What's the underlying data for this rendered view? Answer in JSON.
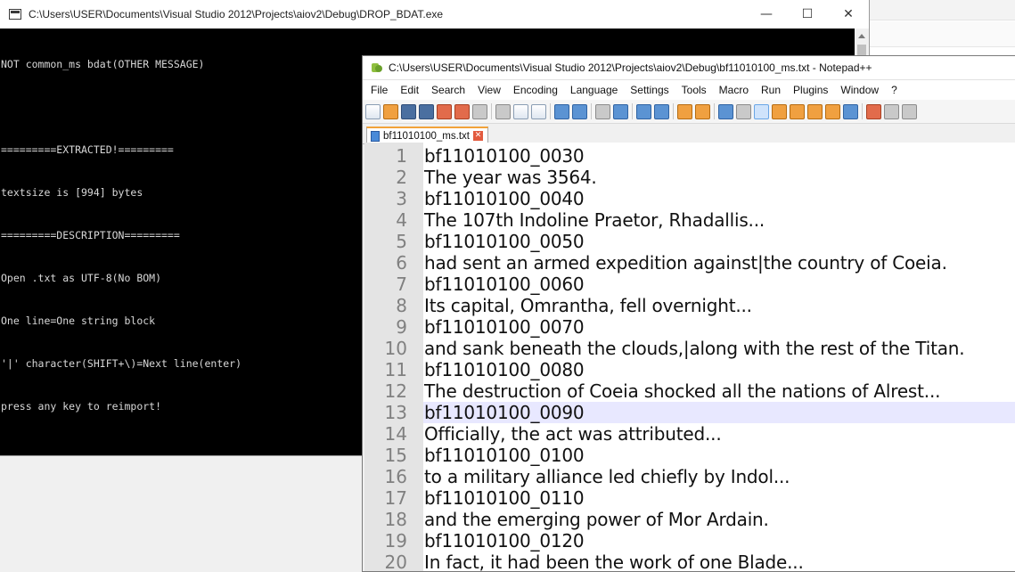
{
  "console": {
    "title": "C:\\Users\\USER\\Documents\\Visual Studio 2012\\Projects\\aiov2\\Debug\\DROP_BDAT.exe",
    "lines": [
      "NOT common_ms bdat(OTHER MESSAGE)",
      "",
      "=========EXTRACTED!=========",
      "textsize is [994] bytes",
      "=========DESCRIPTION=========",
      "Open .txt as UTF-8(No BOM)",
      "One line=One string block",
      "'|' character(SHIFT+\\)=Next line(enter)",
      "press any key to reimport!"
    ]
  },
  "window_buttons": {
    "minimize": "—",
    "maximize": "☐",
    "close": "✕"
  },
  "notepad": {
    "title": "C:\\Users\\USER\\Documents\\Visual Studio 2012\\Projects\\aiov2\\Debug\\bf11010100_ms.txt - Notepad++",
    "menu": [
      "File",
      "Edit",
      "Search",
      "View",
      "Encoding",
      "Language",
      "Settings",
      "Tools",
      "Macro",
      "Run",
      "Plugins",
      "Window",
      "?"
    ],
    "tab_label": "bf11010100_ms.txt",
    "current_line": 13,
    "lines": [
      {
        "n": "1",
        "text": "bf11010100_0030"
      },
      {
        "n": "2",
        "text": "The year was 3564."
      },
      {
        "n": "3",
        "text": "bf11010100_0040"
      },
      {
        "n": "4",
        "text": "The 107th Indoline Praetor, Rhadallis..."
      },
      {
        "n": "5",
        "text": "bf11010100_0050"
      },
      {
        "n": "6",
        "text": "had sent an armed expedition against|the country of Coeia."
      },
      {
        "n": "7",
        "text": "bf11010100_0060"
      },
      {
        "n": "8",
        "text": "Its capital, Omrantha, fell overnight..."
      },
      {
        "n": "9",
        "text": "bf11010100_0070"
      },
      {
        "n": "10",
        "text": "and sank beneath the clouds,|along with the rest of the Titan."
      },
      {
        "n": "11",
        "text": "bf11010100_0080"
      },
      {
        "n": "12",
        "text": "The destruction of Coeia shocked all the nations of Alrest..."
      },
      {
        "n": "13",
        "text": "bf11010100_0090"
      },
      {
        "n": "14",
        "text": "Officially, the act was attributed..."
      },
      {
        "n": "15",
        "text": "bf11010100_0100"
      },
      {
        "n": "16",
        "text": "to a military alliance led chiefly by Indol..."
      },
      {
        "n": "17",
        "text": "bf11010100_0110"
      },
      {
        "n": "18",
        "text": "and the emerging power of Mor Ardain."
      },
      {
        "n": "19",
        "text": "bf11010100_0120"
      },
      {
        "n": "20",
        "text": "In fact, it had been the work of one Blade..."
      }
    ]
  }
}
